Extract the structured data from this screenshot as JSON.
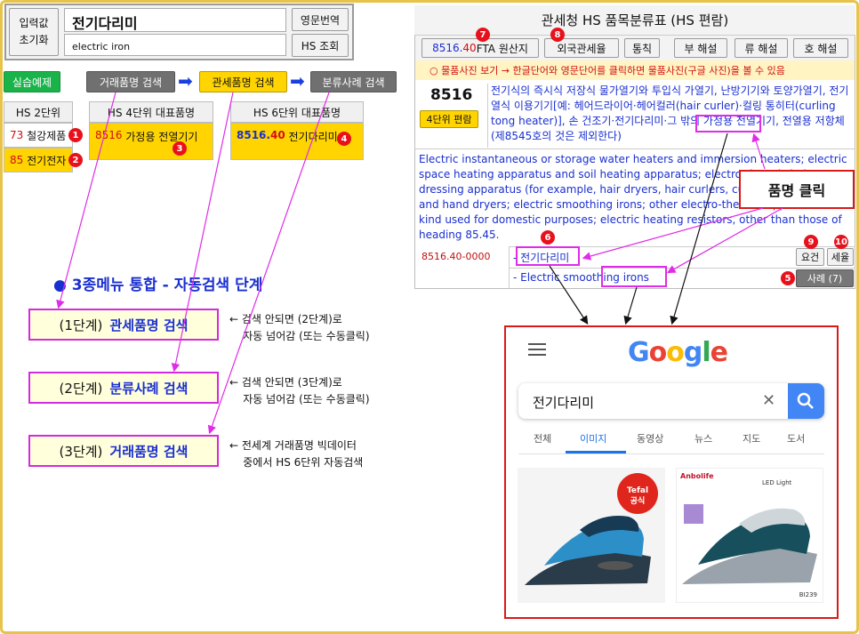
{
  "left_panel": {
    "reset_button": "입력값\n초기화",
    "query_kr": "전기다리미",
    "query_en": "electric iron",
    "translate_button": "영문번역",
    "hs_lookup_button": "HS 조회",
    "practice_button": "실습예제",
    "trade_search_button": "거래품명 검색",
    "customs_search_button": "관세품명 검색",
    "case_search_button": "분류사례 검색",
    "col_hs2": "HS 2단위",
    "col_hs4": "HS 4단위 대표품명",
    "col_hs6": "HS 6단위 대표품명",
    "hs2_rows": [
      {
        "code": "73",
        "name": "철강제품"
      },
      {
        "code": "85",
        "name": "전기전자"
      }
    ],
    "hs4_row": {
      "code": "8516",
      "name": "가정용 전열기기"
    },
    "hs6_row": {
      "code_main": "8516.",
      "code_sub": "40",
      "name": "전기다리미"
    },
    "badges": [
      "1",
      "2",
      "3",
      "4",
      "5",
      "6",
      "7",
      "8",
      "9",
      "10"
    ]
  },
  "steps": {
    "heading": "3종메뉴 통합 - 자동검색 단계",
    "items": [
      {
        "prefix": "(1단계)",
        "name": "관세품명 검색",
        "note": "← 검색 안되면 (2단계)로\n    자동 넘어감 (또는 수동클릭)"
      },
      {
        "prefix": "(2단계)",
        "name": "분류사례 검색",
        "note": "← 검색 안되면 (3단계)로\n    자동 넘어감 (또는 수동클릭)"
      },
      {
        "prefix": "(3단계)",
        "name": "거래품명 검색",
        "note": "← 전세계 거래품명 빅데이터\n    중에서 HS 6단위 자동검색"
      }
    ]
  },
  "right_panel": {
    "title": "관세청 HS 품목분류표 (HS 편람)",
    "fta_code_main": "8516.",
    "fta_code_sub": "40",
    "fta_label": " FTA 원산지",
    "tabs": [
      "외국관세율",
      "통칙",
      "부 해설",
      "류 해설",
      "호 해설"
    ],
    "notice": "○ 물품사진 보기 → 한글단어와 영문단어를 클릭하면 물품사진(구글 사진)을 볼 수 있음",
    "heading_code": "8516",
    "heading_button": "4단위 편람",
    "heading_desc_kr": "전기식의 즉시식 저장식 물가열기와 투입식 가열기, 난방기기와 토양가열기, 전기열식 이용기기[예: 헤어드라이어·헤어컬러(hair curler)·컬링 통히터(curling tong heater)], 손 건조기·전기다리미·그 밖의 가정용 전열기기, 전열용 저항체(제8545호의 것은 제외한다)",
    "heading_desc_en": "Electric instantaneous or storage water heaters and immersion heaters; electric space heating apparatus and soil heating apparatus; electro-thermic hair-dressing apparatus (for example, hair dryers, hair curlers, curling tong heaters) and hand dryers; electric smoothing irons; other electro-thermic appliances of a kind used for domestic purposes; electric heating resistors, other than those of heading 85.45.",
    "sub_code": "8516.40-0000",
    "sub_name_kr": "- 전기다리미",
    "sub_name_en": "- Electric smoothing irons",
    "btn_requirement": "요건",
    "btn_rate": "세율",
    "btn_cases": "사례 (7)",
    "callout": "품명 클릭"
  },
  "google": {
    "logo": "Google",
    "query": "전기다리미",
    "tabs": [
      "전체",
      "이미지",
      "동영상",
      "뉴스",
      "지도",
      "도서"
    ],
    "active_tab": "이미지",
    "img1_brand": "Tefal",
    "img1_badge": "공식",
    "img2_brand": "Anbolife",
    "img2_label": "LED Light",
    "img2_model": "BI239"
  }
}
